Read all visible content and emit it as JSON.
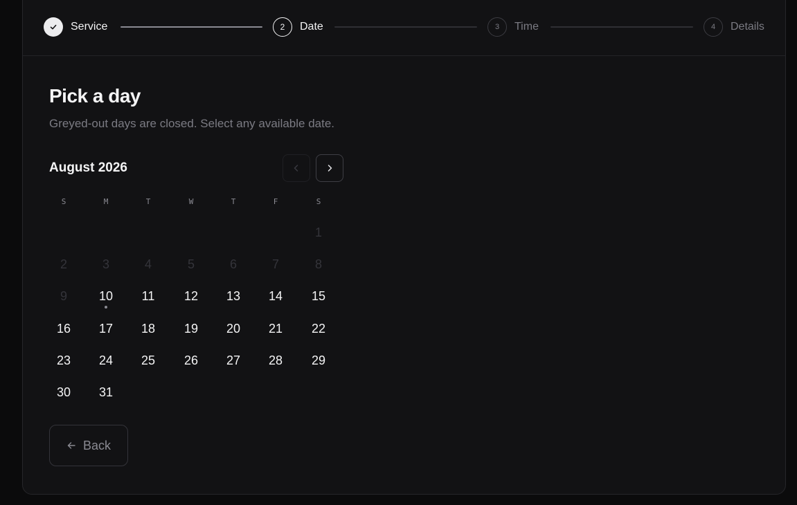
{
  "stepper": {
    "steps": [
      {
        "number": "1",
        "label": "Service",
        "state": "done",
        "icon": "check-icon"
      },
      {
        "number": "2",
        "label": "Date",
        "state": "active"
      },
      {
        "number": "3",
        "label": "Time",
        "state": "pending"
      },
      {
        "number": "4",
        "label": "Details",
        "state": "pending"
      }
    ]
  },
  "main": {
    "title": "Pick a day",
    "subtitle": "Greyed-out days are closed. Select any available date."
  },
  "calendar": {
    "month_label": "August 2026",
    "prev_icon": "chevron-left-icon",
    "next_icon": "chevron-right-icon",
    "prev_enabled": false,
    "next_enabled": true,
    "weekdays": [
      "S",
      "M",
      "T",
      "W",
      "T",
      "F",
      "S"
    ],
    "first_weekday_index": 6,
    "days_in_month": 31,
    "closed_days": [
      1,
      2,
      3,
      4,
      5,
      6,
      7,
      8,
      9
    ],
    "today": 10
  },
  "actions": {
    "back_label": "Back",
    "back_icon": "arrow-left-icon"
  },
  "colors": {
    "background": "#0b0b0c",
    "card": "#121214",
    "text_primary": "#f4f4f5",
    "text_muted": "#7b7b83",
    "text_disabled": "#34343a",
    "connector_done": "#8a8a92",
    "connector_pending": "#2f2f34"
  }
}
